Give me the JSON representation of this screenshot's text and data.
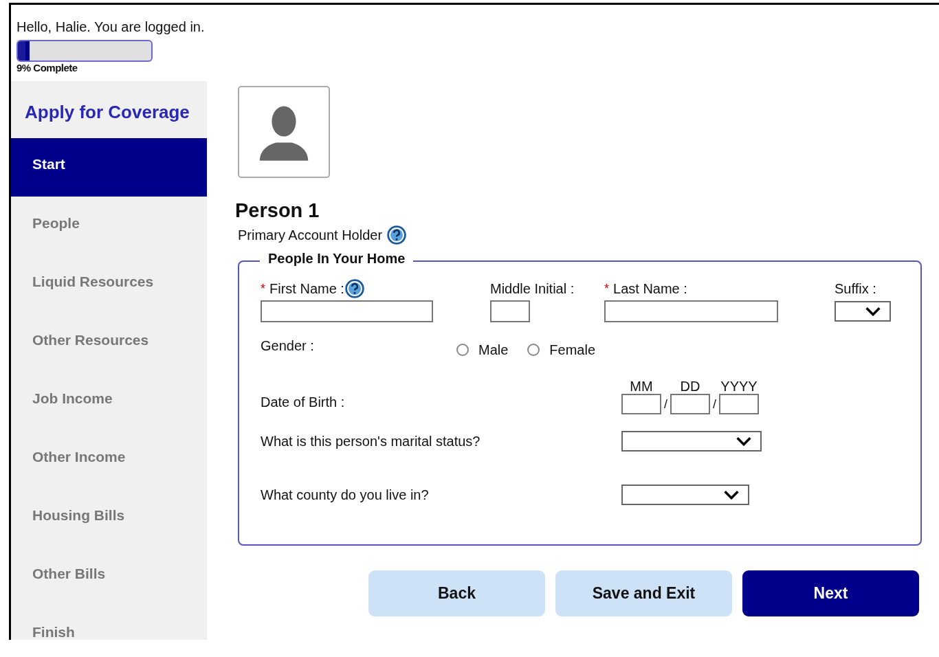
{
  "greeting": "Hello, Halie. You are logged in.",
  "progress": {
    "level": 0.09,
    "label": "9% Complete"
  },
  "sidebar": {
    "title": "Apply for Coverage",
    "items": [
      {
        "label": "Start",
        "selected": true
      },
      {
        "label": "People",
        "selected": false
      },
      {
        "label": "Liquid Resources",
        "selected": false
      },
      {
        "label": "Other Resources",
        "selected": false
      },
      {
        "label": "Job Income",
        "selected": false
      },
      {
        "label": "Other Income",
        "selected": false
      },
      {
        "label": "Housing Bills",
        "selected": false
      },
      {
        "label": "Other Bills",
        "selected": false
      },
      {
        "label": "Finish",
        "selected": false
      }
    ]
  },
  "person": {
    "title": "Person 1",
    "subtitle": "Primary Account Holder",
    "help": true
  },
  "section": {
    "legend": "People In Your Home",
    "name_fields": [
      {
        "label": "First Name :",
        "required_mark": "*",
        "help": true,
        "kind": "text"
      },
      {
        "label": "Middle Initial :",
        "kind": "text"
      },
      {
        "label": "Last Name :",
        "required_mark": "*",
        "kind": "text"
      },
      {
        "label": "Suffix :",
        "kind": "select"
      }
    ],
    "gender": {
      "label": "Gender :",
      "options": [
        {
          "label": "Male",
          "selected": false
        },
        {
          "label": "Female",
          "selected": false
        }
      ]
    },
    "birth_date": {
      "label": "Date of Birth :",
      "parts": [
        "MM",
        "DD",
        "YYYY"
      ],
      "separator": "/"
    },
    "questions": [
      {
        "label": "What is this person's marital status?",
        "kind": "select"
      },
      {
        "label": "What county do you live in?",
        "kind": "select"
      }
    ]
  },
  "buttons": [
    {
      "label": "Back",
      "kind": "secondary"
    },
    {
      "label": "Save and Exit",
      "kind": "secondary"
    },
    {
      "label": "Next",
      "kind": "primary"
    }
  ]
}
